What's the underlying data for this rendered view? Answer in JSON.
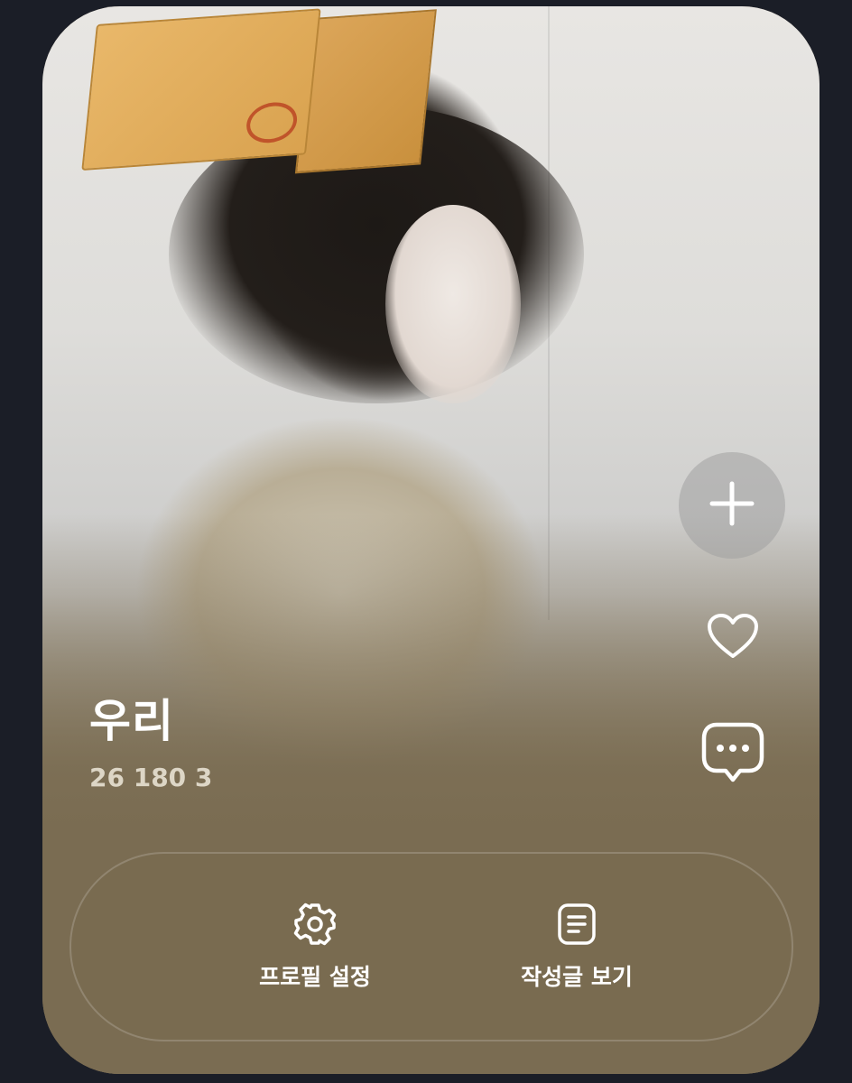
{
  "profile": {
    "name": "우리",
    "stats": [
      "26",
      "180",
      "3"
    ]
  },
  "side_actions": {
    "add": "plus-icon",
    "like": "heart-icon",
    "chat": "chat-bubble-icon"
  },
  "actions": {
    "profile_settings_label": "프로필 설정",
    "view_posts_label": "작성글 보기"
  },
  "colors": {
    "page_background": "#1b1e27",
    "card_background": "#7a6c52",
    "text": "#ffffff",
    "stats_text": "#ddd6c6"
  }
}
